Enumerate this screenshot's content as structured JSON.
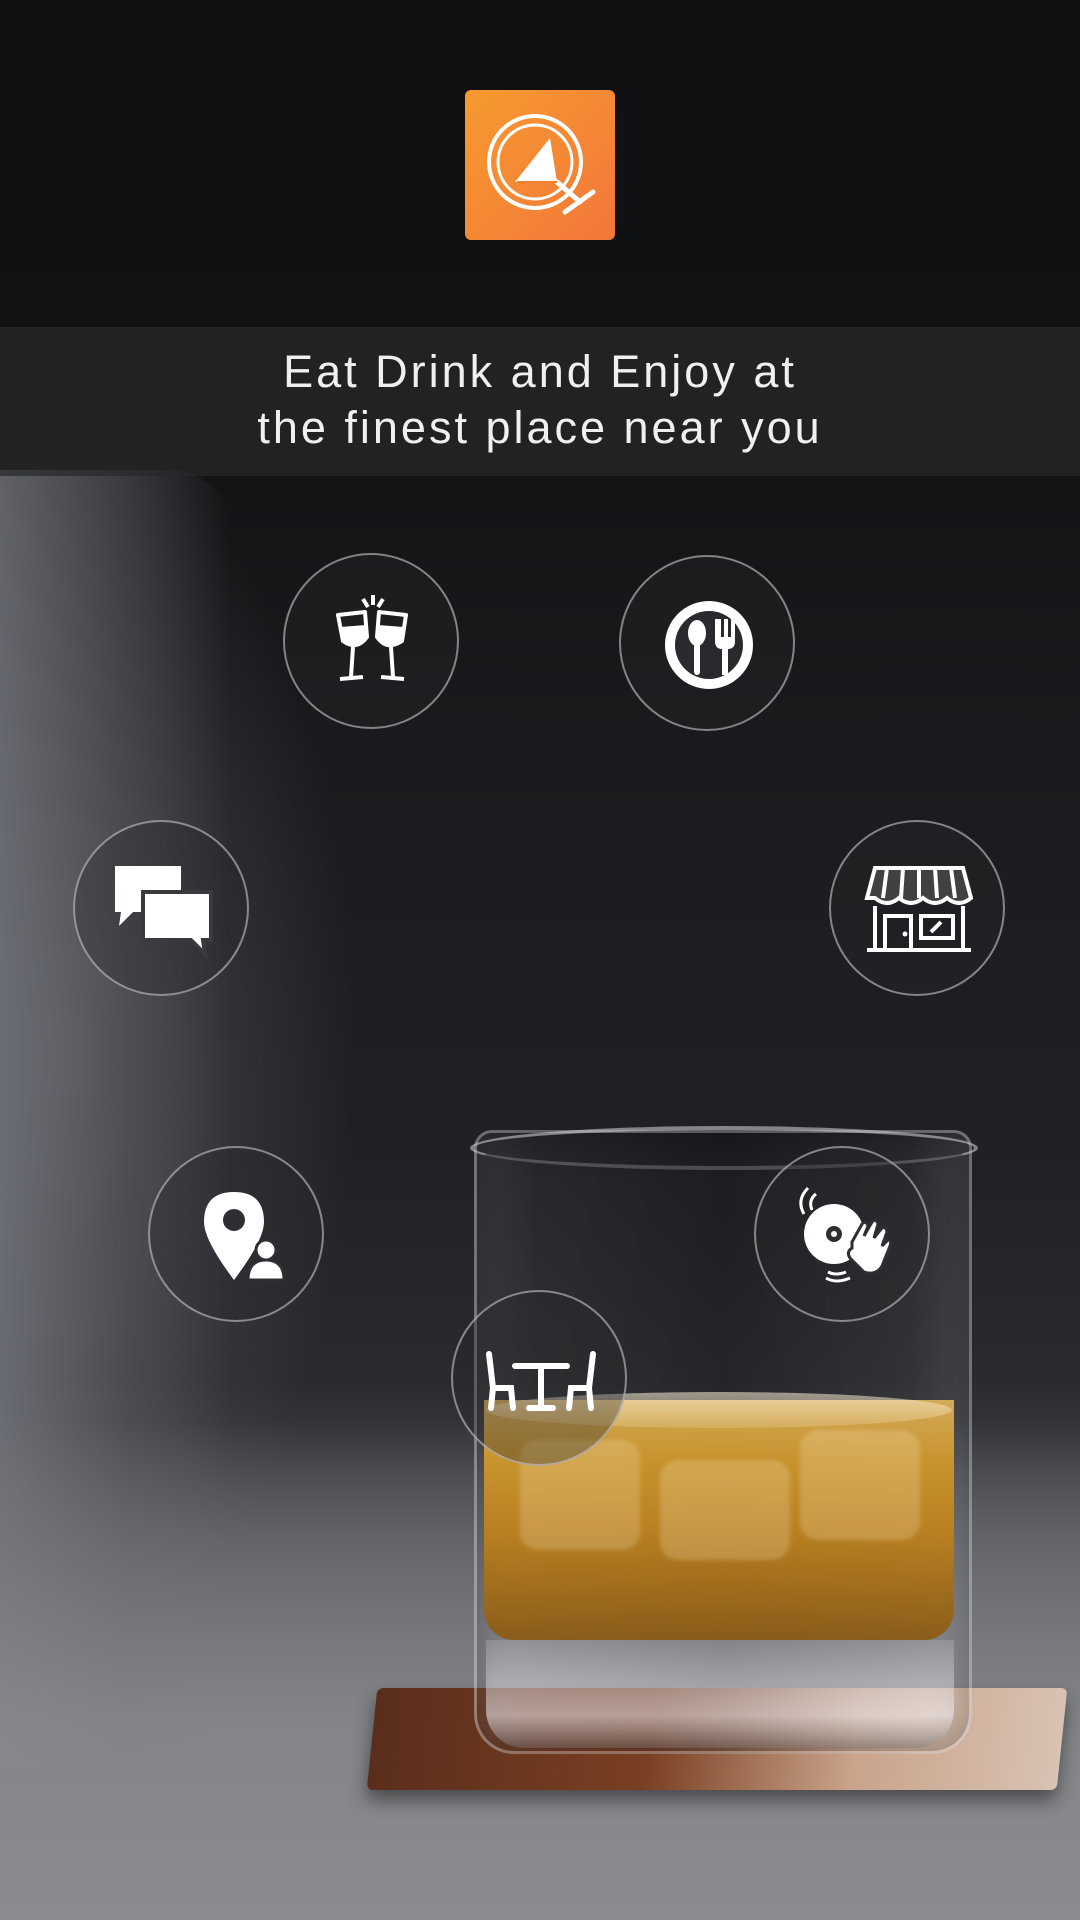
{
  "app": {
    "logo_icon": "glass-clock-logo-icon",
    "brand_color": "#f47f35"
  },
  "tagline": {
    "line1": "Eat Drink and Enjoy at",
    "line2": "the finest place near you"
  },
  "features": [
    {
      "icon": "wine-glasses-toast-icon"
    },
    {
      "icon": "plate-spoon-fork-icon"
    },
    {
      "icon": "chat-bubbles-icon"
    },
    {
      "icon": "storefront-icon"
    },
    {
      "icon": "location-person-icon"
    },
    {
      "icon": "dj-turntable-icon"
    },
    {
      "icon": "table-chairs-icon"
    }
  ]
}
